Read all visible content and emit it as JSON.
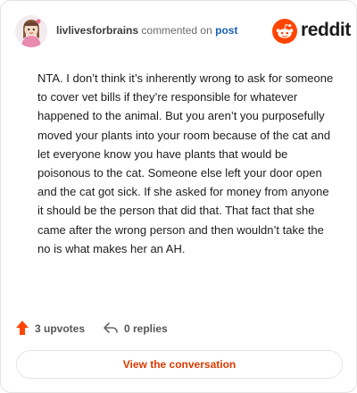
{
  "header": {
    "username": "livlivesforbrains",
    "action_text": "commented on",
    "post_link": "post",
    "brand": "reddit"
  },
  "comment": {
    "body": "NTA. I don’t think it’s inherently wrong to ask for someone to cover vet bills if they’re responsible for whatever happened to the animal. But you aren’t you purposefully moved your plants into your room because of the cat and let everyone know you have plants that would be poisonous to the cat. Someone else left your door open and the cat got sick. If she asked for money from anyone it should be the person that did that. That fact that she came after the wrong person and then wouldn’t take the no is what makes her an AH."
  },
  "footer": {
    "upvotes": "3 upvotes",
    "replies": "0 replies",
    "view_button": "View the conversation"
  },
  "icons": {
    "upvote": "upvote-arrow-icon",
    "reply": "reply-arrow-icon",
    "brand": "reddit-snoo-icon",
    "avatar": "user-avatar"
  },
  "colors": {
    "upvote": "#ff4500",
    "brand_orange": "#ff4500",
    "link": "#1a5fb4",
    "button_text": "#d93a00"
  }
}
